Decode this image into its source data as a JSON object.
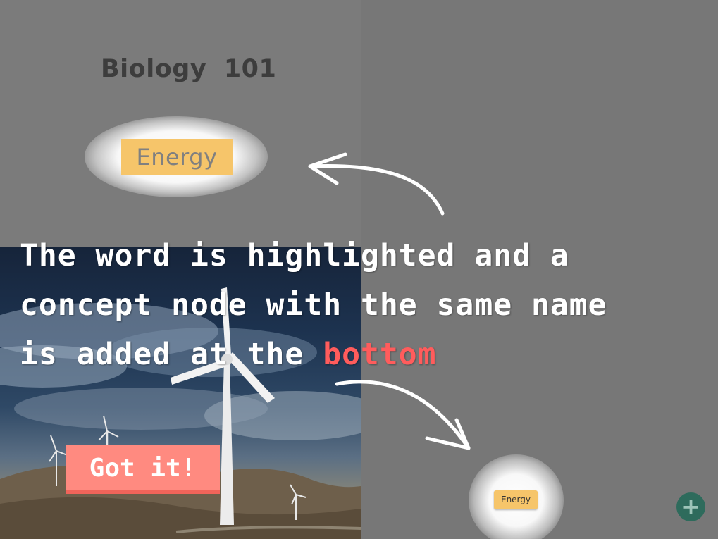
{
  "document": {
    "title": "Biology  101",
    "highlighted_word": "Energy"
  },
  "concept_map": {
    "node_label": "Energy",
    "add_button_label": "+"
  },
  "tutorial": {
    "line1": "The word is highlighted and a",
    "line2": "concept node with the same name",
    "line3_prefix": "is added at the ",
    "line3_accent": "bottom",
    "dismiss_label": "Got it!"
  },
  "colors": {
    "highlight": "#f6c56a",
    "accent_text": "#ff5c5c",
    "dismiss_button": "#ff8a80",
    "add_button": "#2e6b5c"
  }
}
